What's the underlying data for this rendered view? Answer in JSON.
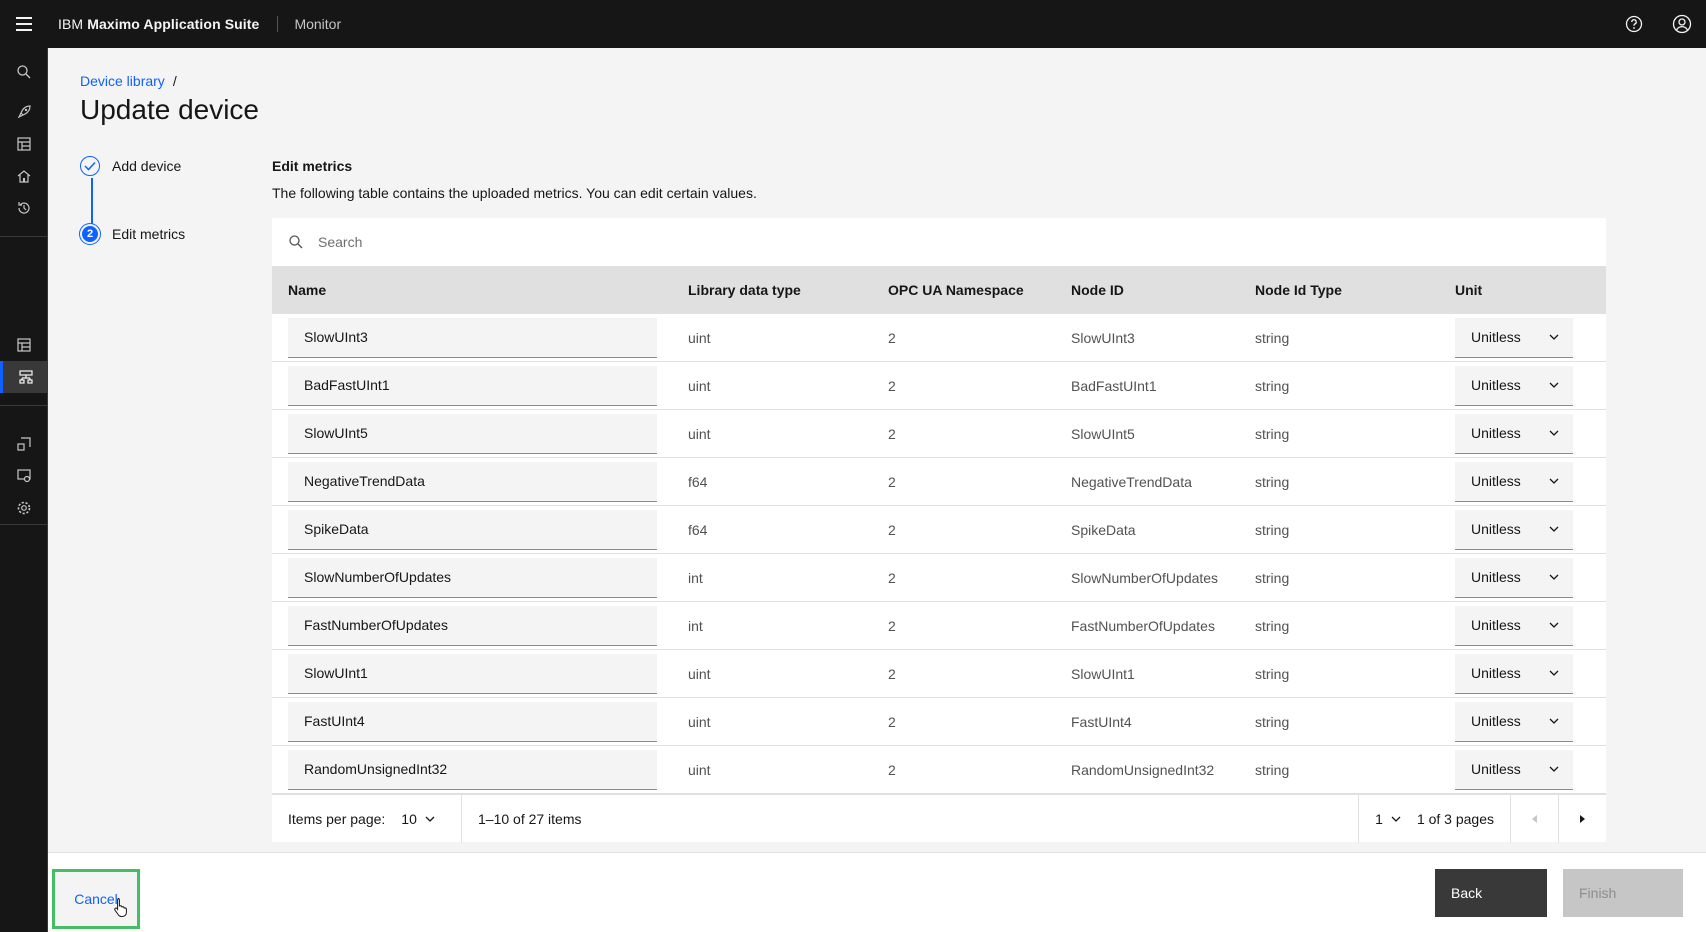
{
  "header": {
    "brand_prefix": "IBM",
    "brand_name": "Maximo Application Suite",
    "product": "Monitor",
    "icons": [
      "menu-icon",
      "help-icon",
      "user-avatar-icon"
    ]
  },
  "sidenav": {
    "icons": [
      "search-icon",
      "rocket-icon",
      "dashboard-icon",
      "home-icon",
      "history-icon",
      "grid-icon",
      "device-library-icon",
      "device-type-icon",
      "device-alert-icon",
      "settings-icon"
    ],
    "active": "device-library-icon"
  },
  "breadcrumb": {
    "link": "Device library",
    "separator": "/"
  },
  "page_title": "Update device",
  "steps": [
    {
      "label": "Add device",
      "state": "complete"
    },
    {
      "label": "Edit metrics",
      "state": "current",
      "number": "2"
    }
  ],
  "section": {
    "title": "Edit metrics",
    "description": "The following table contains the uploaded metrics. You can edit certain values."
  },
  "search": {
    "placeholder": "Search"
  },
  "table": {
    "headers": {
      "name": "Name",
      "type": "Library data type",
      "ns": "OPC UA Namespace",
      "node": "Node ID",
      "nodetype": "Node Id Type",
      "unit": "Unit"
    },
    "rows": [
      {
        "name": "SlowUInt3",
        "type": "uint",
        "ns": "2",
        "node": "SlowUInt3",
        "nodetype": "string",
        "unit": "Unitless"
      },
      {
        "name": "BadFastUInt1",
        "type": "uint",
        "ns": "2",
        "node": "BadFastUInt1",
        "nodetype": "string",
        "unit": "Unitless"
      },
      {
        "name": "SlowUInt5",
        "type": "uint",
        "ns": "2",
        "node": "SlowUInt5",
        "nodetype": "string",
        "unit": "Unitless"
      },
      {
        "name": "NegativeTrendData",
        "type": "f64",
        "ns": "2",
        "node": "NegativeTrendData",
        "nodetype": "string",
        "unit": "Unitless"
      },
      {
        "name": "SpikeData",
        "type": "f64",
        "ns": "2",
        "node": "SpikeData",
        "nodetype": "string",
        "unit": "Unitless"
      },
      {
        "name": "SlowNumberOfUpdates",
        "type": "int",
        "ns": "2",
        "node": "SlowNumberOfUpdates",
        "nodetype": "string",
        "unit": "Unitless"
      },
      {
        "name": "FastNumberOfUpdates",
        "type": "int",
        "ns": "2",
        "node": "FastNumberOfUpdates",
        "nodetype": "string",
        "unit": "Unitless"
      },
      {
        "name": "SlowUInt1",
        "type": "uint",
        "ns": "2",
        "node": "SlowUInt1",
        "nodetype": "string",
        "unit": "Unitless"
      },
      {
        "name": "FastUInt4",
        "type": "uint",
        "ns": "2",
        "node": "FastUInt4",
        "nodetype": "string",
        "unit": "Unitless"
      },
      {
        "name": "RandomUnsignedInt32",
        "type": "uint",
        "ns": "2",
        "node": "RandomUnsignedInt32",
        "nodetype": "string",
        "unit": "Unitless"
      }
    ]
  },
  "pagination": {
    "items_per_page_label": "Items per page:",
    "items_per_page": "10",
    "range": "1–10 of 27 items",
    "page": "1",
    "page_of": "1 of 3 pages"
  },
  "footer": {
    "cancel": "Cancel",
    "back": "Back",
    "finish": "Finish"
  },
  "colors": {
    "accent": "#0f62fe",
    "highlight": "#42be65",
    "header": "#161616"
  }
}
